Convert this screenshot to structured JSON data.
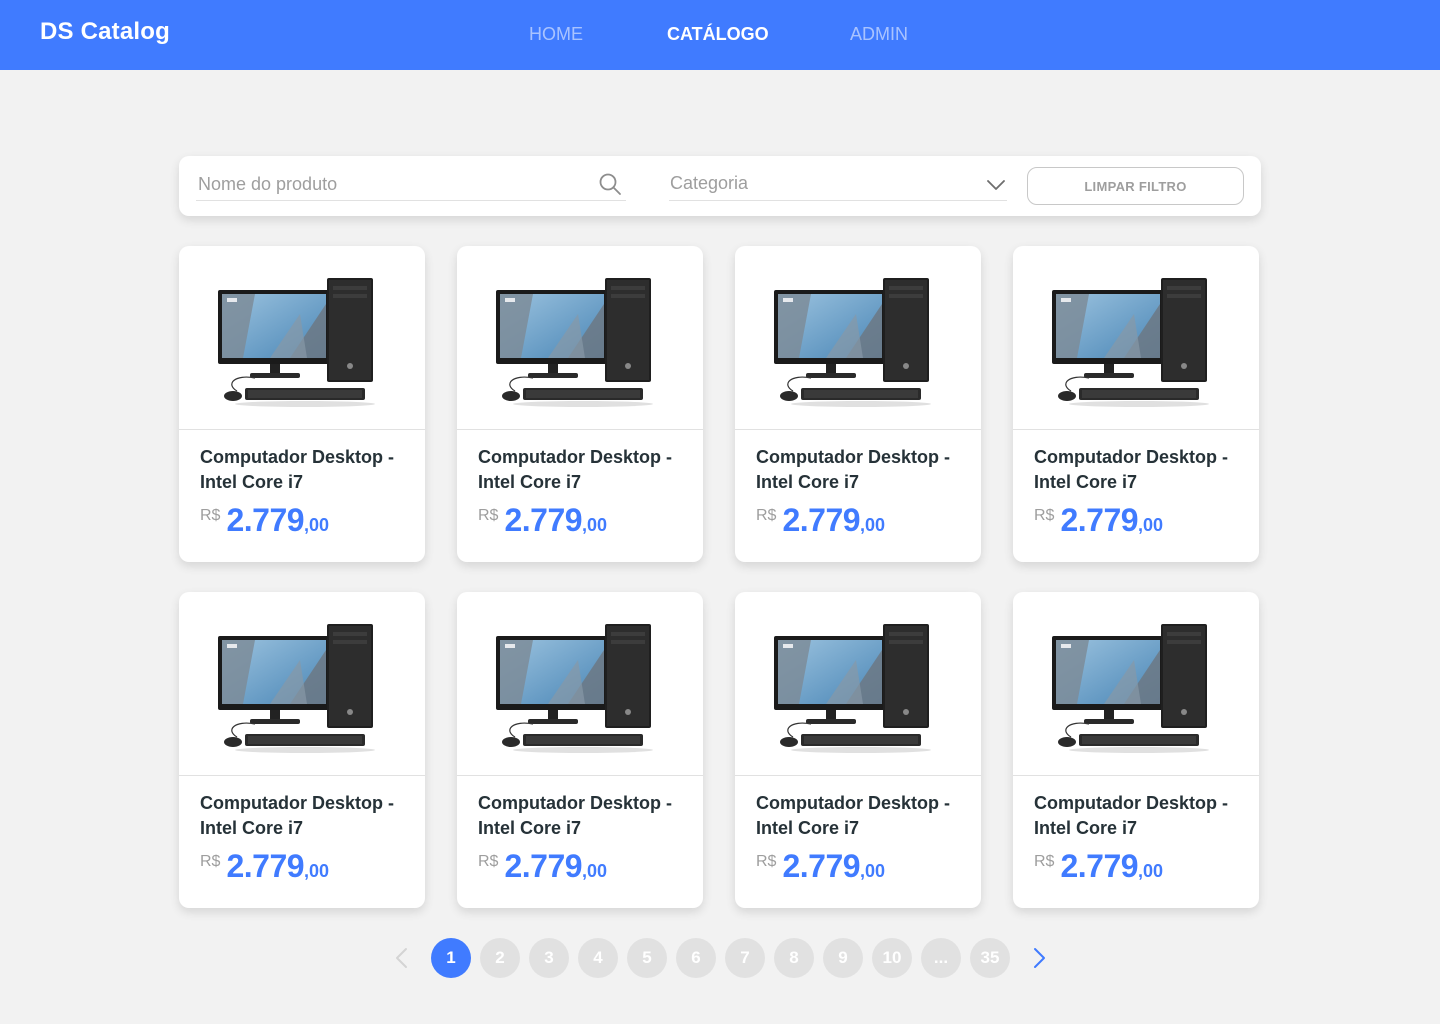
{
  "navbar": {
    "brand": "DS Catalog",
    "links": [
      {
        "label": "HOME",
        "active": false
      },
      {
        "label": "CATÁLOGO",
        "active": true
      },
      {
        "label": "ADMIN",
        "active": false
      }
    ]
  },
  "filter": {
    "search_placeholder": "Nome do produto",
    "category_placeholder": "Categoria",
    "clear_label": "LIMPAR FILTRO"
  },
  "products": [
    {
      "name": "Computador Desktop - Intel Core i7",
      "currency": "R$",
      "price_int": "2.779",
      "price_dec": ",00"
    },
    {
      "name": "Computador Desktop - Intel Core i7",
      "currency": "R$",
      "price_int": "2.779",
      "price_dec": ",00"
    },
    {
      "name": "Computador Desktop - Intel Core i7",
      "currency": "R$",
      "price_int": "2.779",
      "price_dec": ",00"
    },
    {
      "name": "Computador Desktop - Intel Core i7",
      "currency": "R$",
      "price_int": "2.779",
      "price_dec": ",00"
    },
    {
      "name": "Computador Desktop - Intel Core i7",
      "currency": "R$",
      "price_int": "2.779",
      "price_dec": ",00"
    },
    {
      "name": "Computador Desktop - Intel Core i7",
      "currency": "R$",
      "price_int": "2.779",
      "price_dec": ",00"
    },
    {
      "name": "Computador Desktop - Intel Core i7",
      "currency": "R$",
      "price_int": "2.779",
      "price_dec": ",00"
    },
    {
      "name": "Computador Desktop - Intel Core i7",
      "currency": "R$",
      "price_int": "2.779",
      "price_dec": ",00"
    }
  ],
  "pagination": {
    "pages": [
      "1",
      "2",
      "3",
      "4",
      "5",
      "6",
      "7",
      "8",
      "9",
      "10",
      "...",
      "35"
    ],
    "active": "1",
    "prev_icon": "chevron-left-icon",
    "next_icon": "chevron-right-icon"
  },
  "colors": {
    "primary": "#407bff",
    "background": "#f2f2f2",
    "text_dark": "#263238",
    "text_muted": "#9e9e9e",
    "inactive_page": "#e1e1e1"
  }
}
